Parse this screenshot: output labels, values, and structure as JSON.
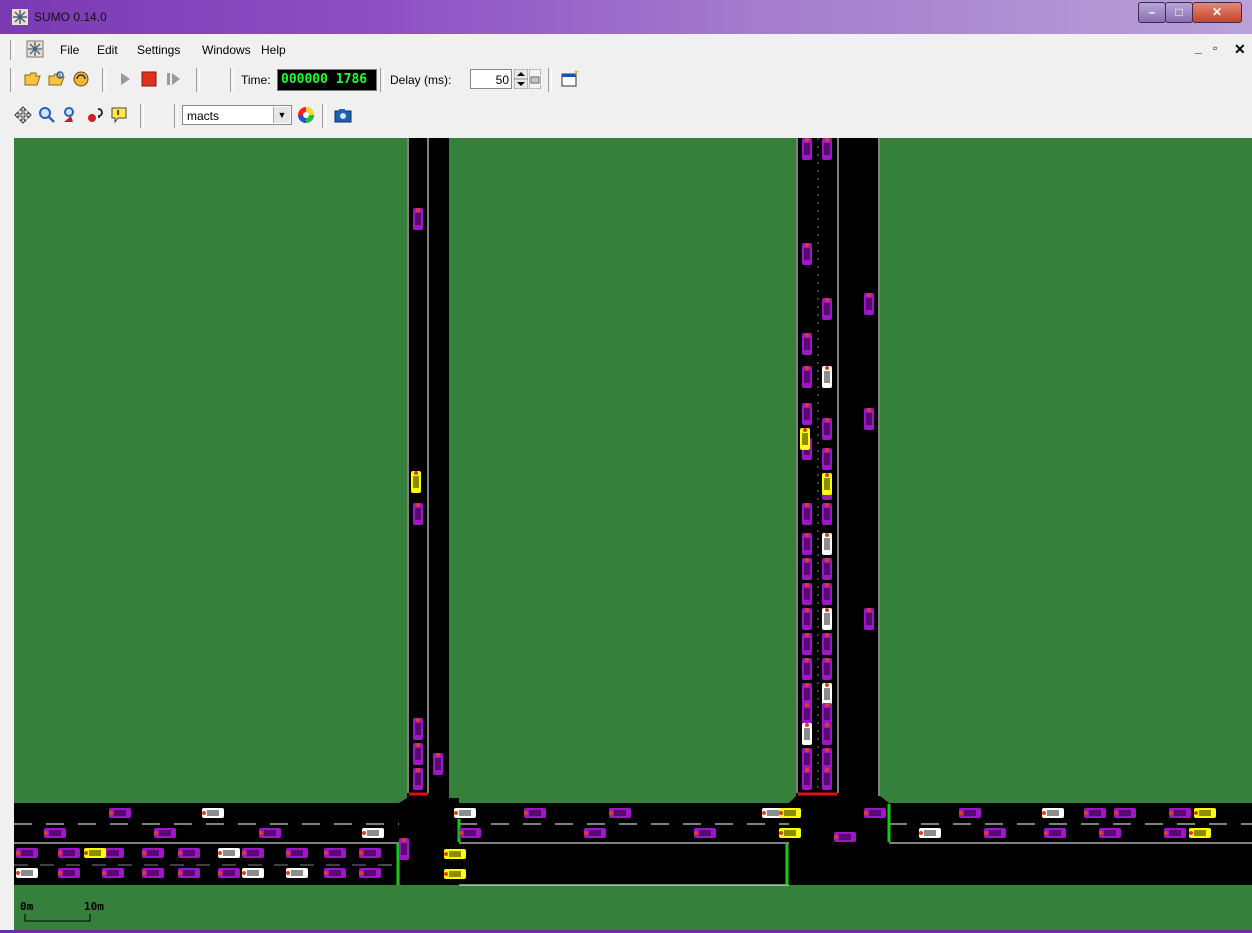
{
  "window": {
    "title": "SUMO 0.14.0"
  },
  "menu": {
    "items": [
      "File",
      "Edit",
      "Settings",
      "Windows",
      "Help"
    ]
  },
  "toolbar": {
    "time_label": "Time:",
    "time_value": "000000 1786",
    "delay_label": "Delay (ms):",
    "delay_value": "50"
  },
  "view_toolbar": {
    "scheme_value": "macts"
  },
  "scale": {
    "zero": "0m",
    "ten": "10m"
  },
  "colors": {
    "grass": "#35803a",
    "road": "#000000",
    "vehicle": "#9d17c9",
    "vehicle_alt": "#ffffff",
    "highlight": "#ffff00",
    "signal_green": "#10d010",
    "signal_red": "#e01010"
  },
  "icons": [
    "app-icon",
    "open-icon",
    "reload-icon",
    "close-network-icon",
    "run-icon",
    "stop-icon",
    "step-icon",
    "new-view-icon",
    "recenter-icon",
    "zoom-icon",
    "locate-icon",
    "tracker-icon",
    "tooltip-icon",
    "color-wheel-icon",
    "screenshot-icon"
  ]
}
